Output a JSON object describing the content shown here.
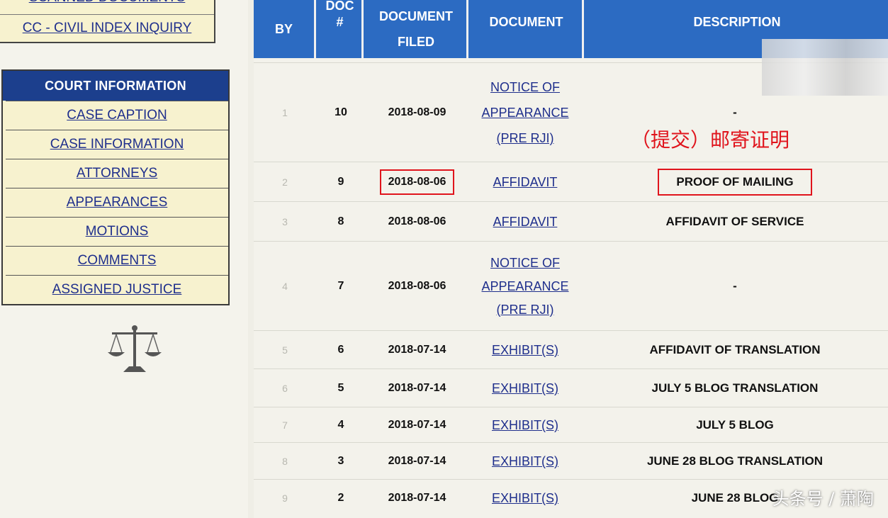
{
  "sidebar": {
    "top_links": [
      "SCANNED DOCUMENTS",
      "CC - CIVIL INDEX INQUIRY"
    ],
    "court_header": "COURT INFORMATION",
    "court_items": [
      "CASE CAPTION",
      "CASE INFORMATION",
      "ATTORNEYS",
      "APPEARANCES",
      "MOTIONS",
      "COMMENTS",
      "ASSIGNED JUSTICE"
    ],
    "scales_icon": "scales-of-justice-icon"
  },
  "table": {
    "headers": {
      "by": "BY",
      "num_line1": "DOC",
      "num_line2": "#",
      "filed_line1": "DOCUMENT",
      "filed_line2": "FILED",
      "document": "DOCUMENT",
      "description": "DESCRIPTION"
    },
    "rows": [
      {
        "by": "1",
        "num": "10",
        "date": "2018-08-09",
        "doc_lines": [
          "NOTICE OF",
          "APPEARANCE",
          "(PRE RJI)"
        ],
        "desc": "-"
      },
      {
        "by": "2",
        "num": "9",
        "date": "2018-08-06",
        "doc_lines": [
          "AFFIDAVIT"
        ],
        "desc": "PROOF OF MAILING"
      },
      {
        "by": "3",
        "num": "8",
        "date": "2018-08-06",
        "doc_lines": [
          "AFFIDAVIT"
        ],
        "desc": "AFFIDAVIT OF SERVICE"
      },
      {
        "by": "4",
        "num": "7",
        "date": "2018-08-06",
        "doc_lines": [
          "NOTICE OF",
          "APPEARANCE",
          "(PRE RJI)"
        ],
        "desc": "-"
      },
      {
        "by": "5",
        "num": "6",
        "date": "2018-07-14",
        "doc_lines": [
          "EXHIBIT(S)"
        ],
        "desc": "AFFIDAVIT OF TRANSLATION"
      },
      {
        "by": "6",
        "num": "5",
        "date": "2018-07-14",
        "doc_lines": [
          "EXHIBIT(S)"
        ],
        "desc": "JULY 5 BLOG TRANSLATION"
      },
      {
        "by": "7",
        "num": "4",
        "date": "2018-07-14",
        "doc_lines": [
          "EXHIBIT(S)"
        ],
        "desc": "JULY 5 BLOG"
      },
      {
        "by": "8",
        "num": "3",
        "date": "2018-07-14",
        "doc_lines": [
          "EXHIBIT(S)"
        ],
        "desc": "JUNE 28 BLOG TRANSLATION"
      },
      {
        "by": "9",
        "num": "2",
        "date": "2018-07-14",
        "doc_lines": [
          "EXHIBIT(S)"
        ],
        "desc": "JUNE 28 BLOG"
      }
    ]
  },
  "annotation": "（提交）邮寄证明",
  "watermark": "头条号 / 萧陶",
  "colors": {
    "header_blue": "#2c6bc2",
    "court_header_blue": "#1c3f8d",
    "link_blue": "#1f2f8c",
    "highlight_red": "#e0141c",
    "sidebar_yellow": "#f7f2cf"
  }
}
